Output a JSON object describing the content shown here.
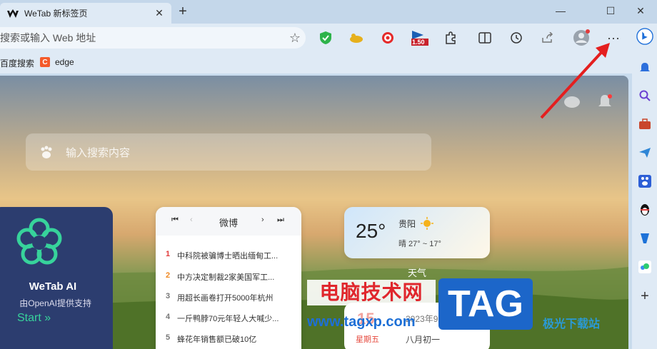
{
  "tab": {
    "title": "WeTab 新标签页",
    "close": "✕",
    "new": "+"
  },
  "window": {
    "minimize": "—",
    "maximize": "☐",
    "close": "✕"
  },
  "address": {
    "text": "搜索或输入 Web 地址",
    "star": "☆"
  },
  "toolbar": {
    "zoom_badge": "1.50",
    "more": "···"
  },
  "bookmarks": [
    {
      "label": "百度搜索"
    },
    {
      "label": "edge",
      "icon": "C"
    }
  ],
  "search": {
    "placeholder": "输入搜索内容"
  },
  "ai_card": {
    "title": "WeTab AI",
    "subtitle": "由OpenAI提供支持",
    "start": "Start »"
  },
  "weibo": {
    "title": "微博",
    "controls": {
      "first": "⏮",
      "prev": "‹",
      "next": "›",
      "last": "⏭"
    },
    "items": [
      {
        "num": "1",
        "text": "中科院被骗博士晒出缅甸工..."
      },
      {
        "num": "2",
        "text": "中方决定制裁2家美国军工..."
      },
      {
        "num": "3",
        "text": "用超长画卷打开5000年杭州"
      },
      {
        "num": "4",
        "text": "一斤鸭脖70元年轻人大喊少..."
      },
      {
        "num": "5",
        "text": "蜂花年销售额已破10亿"
      }
    ]
  },
  "weather": {
    "temp": "25°",
    "city": "贵阳",
    "range": "晴 27° ~ 17°",
    "label": "天气"
  },
  "calendar": {
    "day": "15",
    "weekday": "星期五",
    "month": "2023年9月",
    "lunar": "八月初一"
  },
  "watermark": {
    "cn": "电脑技术网",
    "url": "www.tagxp.com",
    "tag": "TAG",
    "site": "极光下载站"
  },
  "colors": {
    "accent_red": "#e0262c",
    "tag_blue": "#1c66c9",
    "ai_card": "#2c3d6f",
    "start_green": "#37d39b"
  }
}
